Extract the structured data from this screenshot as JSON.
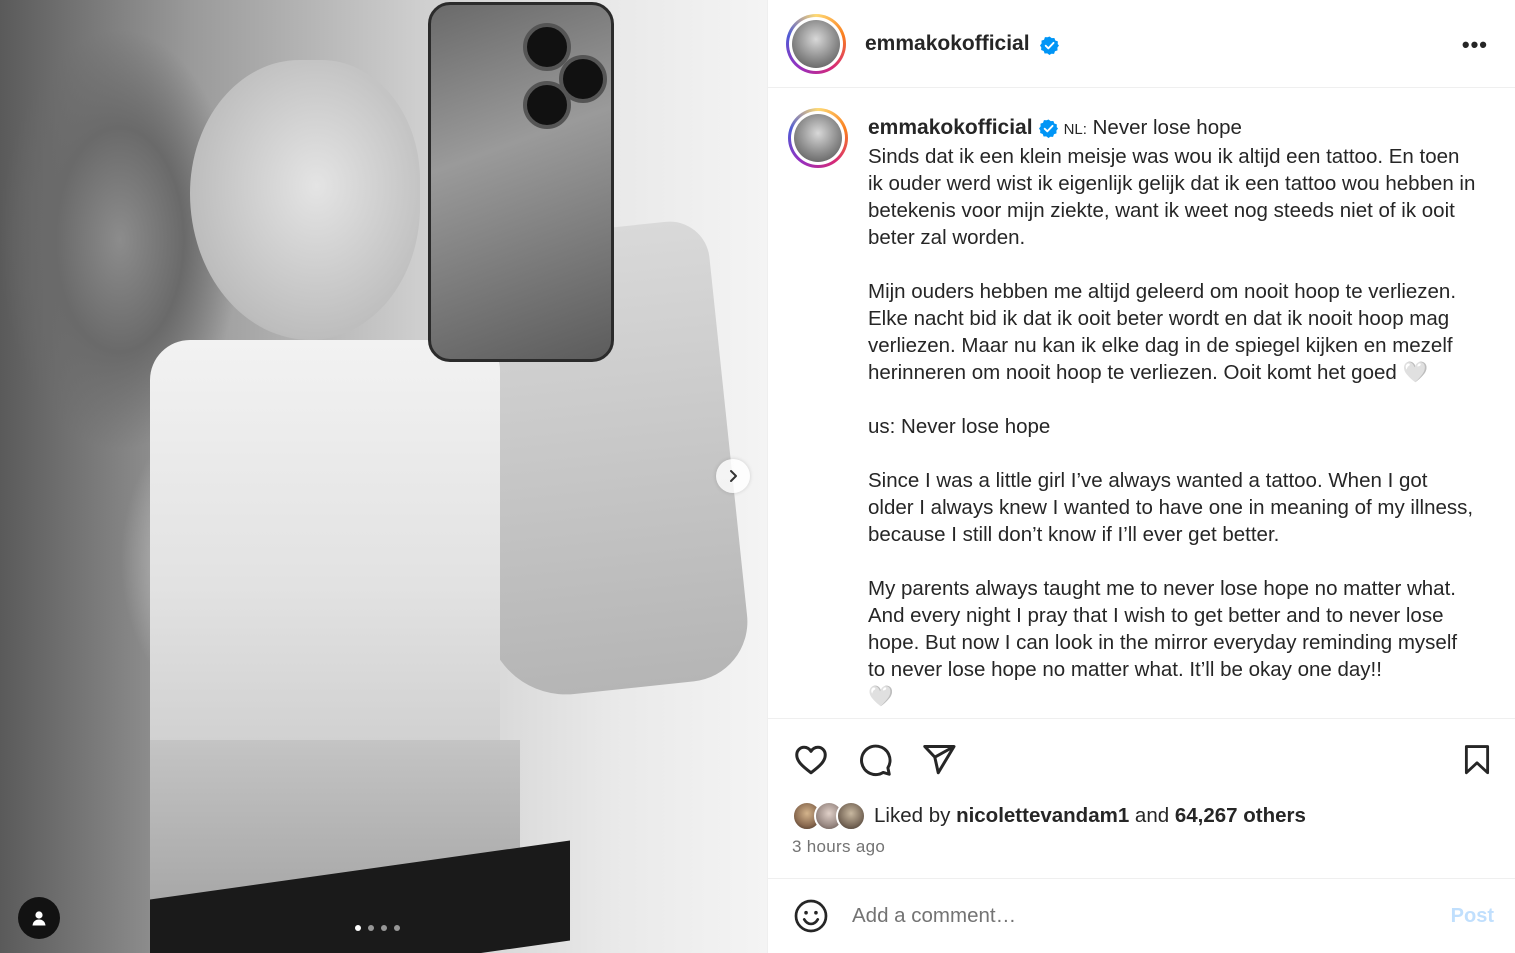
{
  "post": {
    "username": "emmakokofficial",
    "verified": true,
    "more_label": "•••",
    "carousel": {
      "slides": 4,
      "active_index": 0
    }
  },
  "caption": {
    "username": "emmakokofficial",
    "lang": "NL:",
    "text": " Never lose hope\nSinds dat ik een klein meisje was wou ik altijd een tattoo. En toen ik ouder werd wist ik eigenlijk gelijk dat ik een tattoo wou hebben in betekenis voor mijn ziekte, want ik weet nog steeds niet of ik ooit beter zal worden.\n\nMijn ouders hebben me altijd geleerd om nooit hoop te verliezen. Elke nacht bid ik dat ik ooit beter wordt en dat ik nooit hoop mag verliezen. Maar nu kan ik elke dag in de spiegel kijken en mezelf herinneren om nooit hoop te verliezen. Ooit komt het goed 🤍\n\nus: Never lose hope\n\nSince I was a little girl I’ve always wanted a tattoo. When I got older I always knew I wanted to have one in meaning of my illness, because I still don’t know if I’ll ever get better.\n\nMy parents always taught me to never lose hope no matter what. And every night I pray that I wish to get better and to never lose hope. But now I can look in the mirror everyday reminding myself to never lose hope no matter what. It’ll be okay one day!!\n🤍"
  },
  "likes": {
    "prefix": "Liked by ",
    "liker": "nicolettevandam1",
    "middle": " and ",
    "others": "64,267 others"
  },
  "time": "3 hours ago",
  "comment": {
    "placeholder": "Add a comment…",
    "post_label": "Post"
  },
  "colors": {
    "verified": "#0095f6",
    "text": "#262626",
    "muted": "#737373",
    "post_disabled": "#c0dffd"
  },
  "icons": [
    "heart-icon",
    "comment-icon",
    "share-icon",
    "bookmark-icon",
    "emoji-icon",
    "user-tag-icon",
    "chevron-right-icon",
    "verified-icon"
  ]
}
